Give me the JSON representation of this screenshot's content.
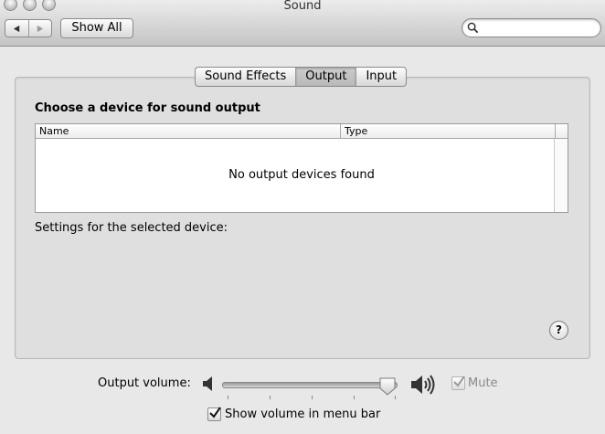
{
  "window": {
    "title": "Sound"
  },
  "toolbar": {
    "show_all_label": "Show All",
    "search_value": ""
  },
  "tabs": [
    {
      "label": "Sound Effects",
      "active": false
    },
    {
      "label": "Output",
      "active": true
    },
    {
      "label": "Input",
      "active": false
    }
  ],
  "output": {
    "heading": "Choose a device for sound output",
    "columns": [
      "Name",
      "Type"
    ],
    "empty_message": "No output devices found",
    "settings_label": "Settings for the selected device:"
  },
  "help": {
    "glyph": "?"
  },
  "volume": {
    "label": "Output volume:",
    "level": 0.95,
    "mute_label": "Mute",
    "mute_checked": true,
    "mute_enabled": false,
    "show_in_menubar_label": "Show volume in menu bar",
    "show_in_menubar_checked": true
  },
  "icons": {
    "back": "back-arrow-icon",
    "forward": "forward-arrow-icon",
    "search": "search-icon",
    "speaker_low": "speaker-low-icon",
    "speaker_high": "speaker-high-icon"
  }
}
